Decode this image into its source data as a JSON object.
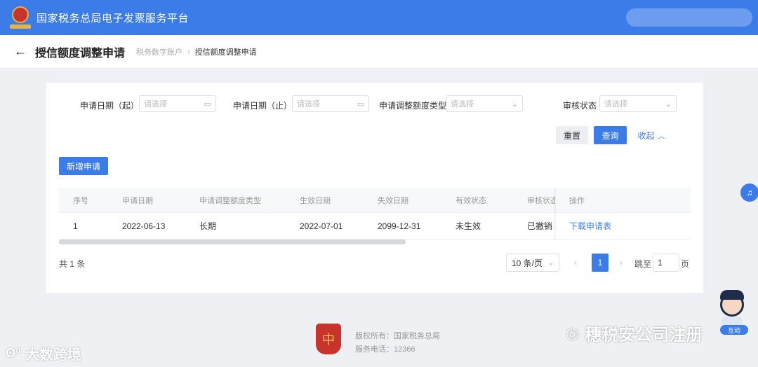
{
  "topbar": {
    "title": "国家税务总局电子发票服务平台"
  },
  "header": {
    "back_icon": "arrow-left-icon",
    "page_title": "授信额度调整申请",
    "breadcrumb": {
      "parent": "税务数字账户",
      "separator": "›",
      "current": "授信额度调整申请"
    }
  },
  "filters": {
    "date_start": {
      "label": "申请日期（起）",
      "placeholder": "请选择"
    },
    "date_end": {
      "label": "申请日期（止）",
      "placeholder": "请选择"
    },
    "adjust_type": {
      "label": "申请调整额度类型",
      "placeholder": "请选择"
    },
    "review_status": {
      "label": "审核状态",
      "placeholder": "请选择"
    }
  },
  "actions": {
    "reset": "重置",
    "query": "查询",
    "collapse": "收起",
    "new_request": "新增申请"
  },
  "table": {
    "columns": [
      "序号",
      "申请日期",
      "申请调整额度类型",
      "生效日期",
      "失效日期",
      "有效状态",
      "审核状态",
      "操作"
    ],
    "rows": [
      {
        "index": "1",
        "apply_date": "2022-06-13",
        "adjust_type": "长期",
        "effective_date": "2022-07-01",
        "expire_date": "2099-12-31",
        "valid_status": "未生效",
        "review_status": "已撤销",
        "operation": "下载申请表"
      }
    ]
  },
  "pagination": {
    "total": "共 1 条",
    "page_size": "10 条/页",
    "prev": "‹",
    "current_page": "1",
    "next": "›",
    "jump_label": "跳至",
    "jump_value": "1",
    "page_suffix": "页"
  },
  "footer": {
    "copyright": "版权所有：国家税务总局",
    "phone": "服务电话：12366",
    "emblem_char": "中"
  },
  "floating": {
    "mascot_badge": "互动"
  },
  "watermarks": {
    "left": "大数跨境",
    "right": "穗税安公司注册"
  },
  "colors": {
    "primary": "#3b7ce9",
    "topbar": "#3b7ce9",
    "emblem": "#c8342b"
  }
}
